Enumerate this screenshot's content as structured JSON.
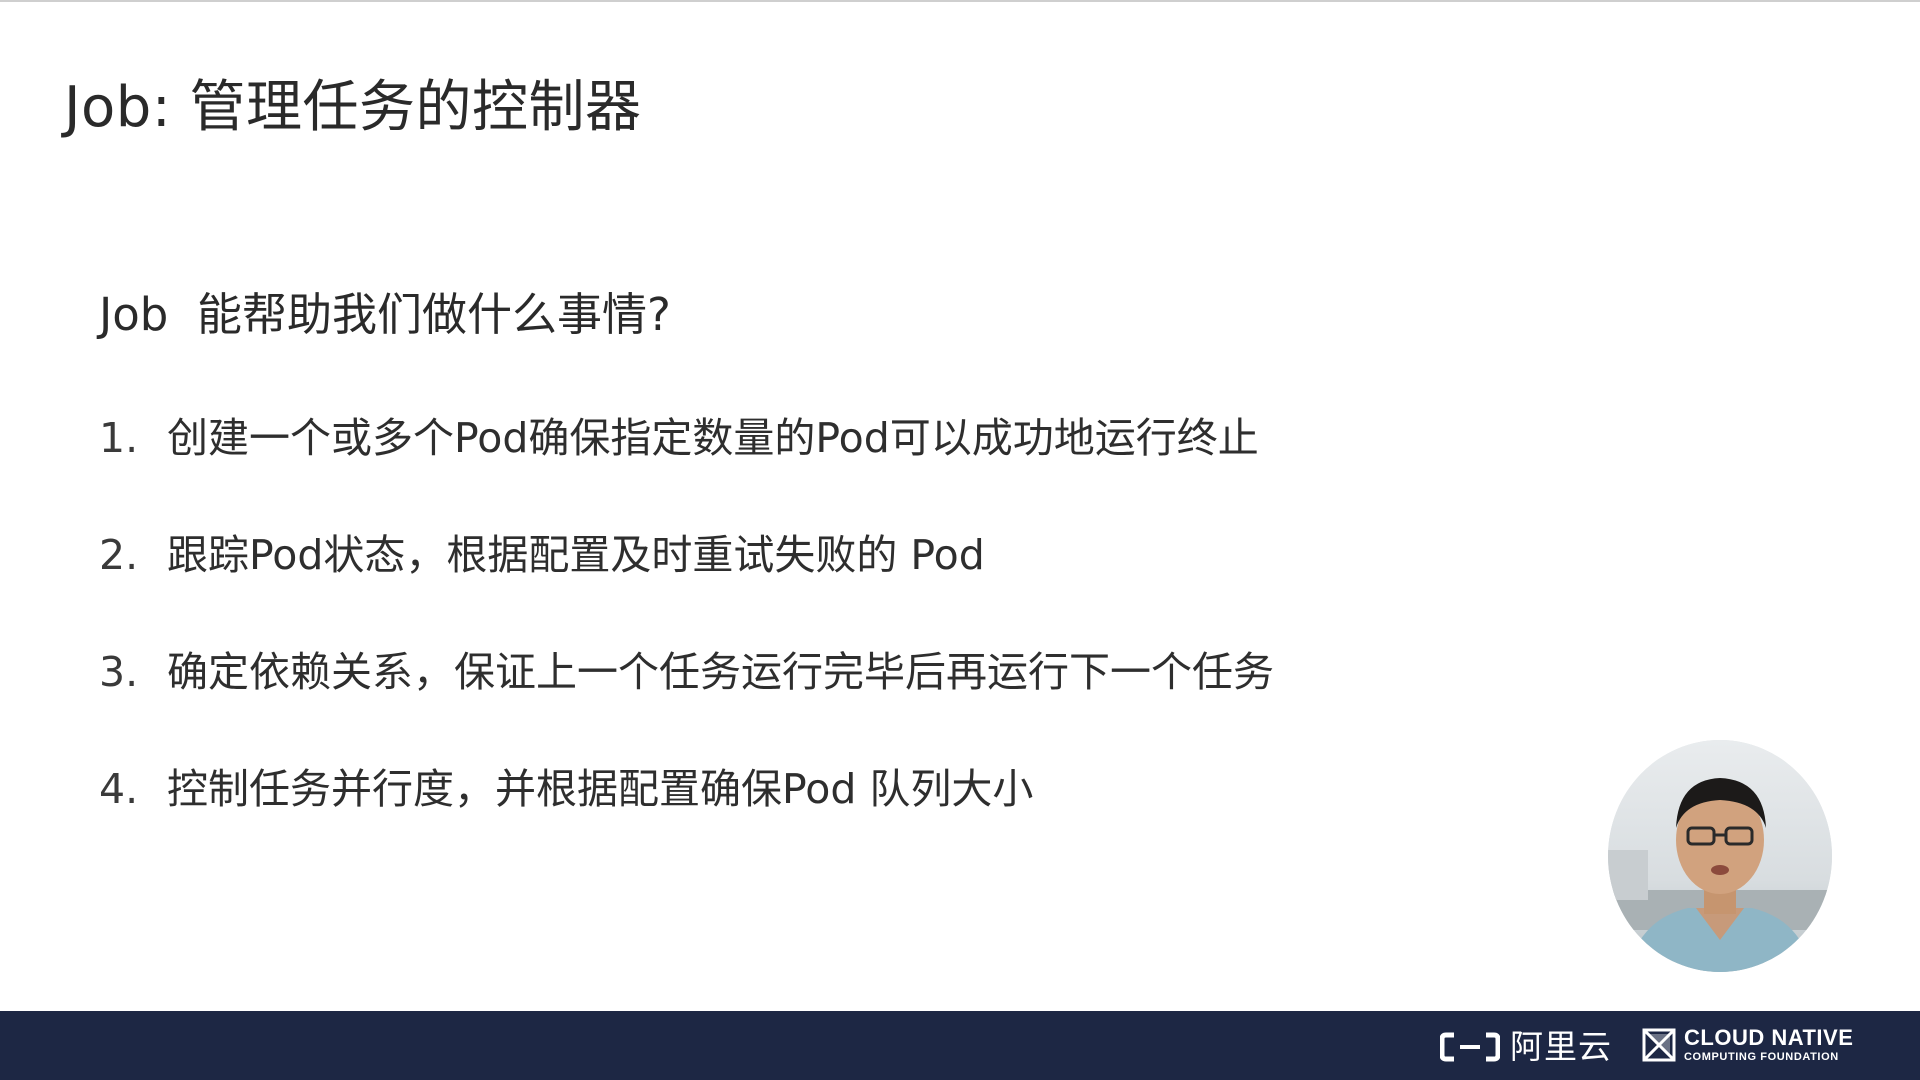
{
  "slide": {
    "title": "Job: 管理任务的控制器",
    "question": "Job  能帮助我们做什么事情?",
    "items": [
      {
        "number": "1.",
        "text": "创建一个或多个Pod确保指定数量的Pod可以成功地运行终止"
      },
      {
        "number": "2.",
        "text": "跟踪Pod状态，根据配置及时重试失败的 Pod"
      },
      {
        "number": "3.",
        "text": "确定依赖关系，保证上一个任务运行完毕后再运行下一个任务"
      },
      {
        "number": "4.",
        "text": "控制任务并行度，并根据配置确保Pod 队列大小"
      }
    ]
  },
  "footer": {
    "alibaba_logo_text": "阿里云",
    "cncf_line1": "CLOUD NATIVE",
    "cncf_line2": "COMPUTING FOUNDATION",
    "bar_color": "#1d2744"
  },
  "icons": {
    "alibaba": "alibaba-cloud-icon",
    "cncf": "cncf-icon",
    "presenter": "presenter-video"
  }
}
